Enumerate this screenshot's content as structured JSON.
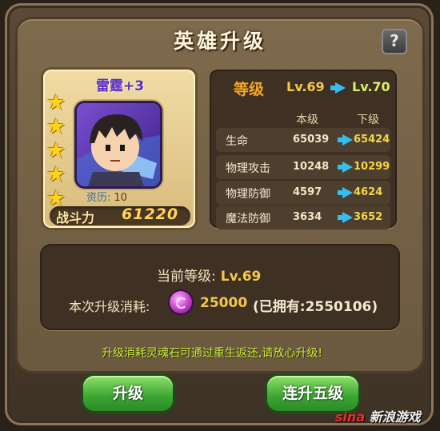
{
  "dialog": {
    "title": "英雄升级",
    "help_label": "?"
  },
  "hero": {
    "name": "雷霆+3",
    "stars": 5,
    "experience_label": "资历:",
    "experience_value": "10",
    "power_label": "战斗力",
    "power_value": "61220"
  },
  "level": {
    "label": "等级",
    "current": "Lv.69",
    "next": "Lv.70"
  },
  "stats": {
    "headers": {
      "current": "本级",
      "next": "下级"
    },
    "rows": [
      {
        "label": "生命",
        "current": "65039",
        "next": "65424"
      },
      {
        "label": "物理攻击",
        "current": "10248",
        "next": "10299"
      },
      {
        "label": "物理防御",
        "current": "4597",
        "next": "4624"
      },
      {
        "label": "魔法防御",
        "current": "3634",
        "next": "3652"
      }
    ]
  },
  "upgrade_info": {
    "current_level_label": "当前等级:",
    "current_level_value": "Lv.69",
    "cost_label": "本次升级消耗:",
    "cost_value": "25000",
    "owned_text": "(已拥有:2550106)"
  },
  "tip": "升级消耗灵魂石可通过重生返还,请放心升级!",
  "buttons": {
    "upgrade": "升级",
    "upgrade_five": "连升五级"
  },
  "watermark": {
    "logo": "sina",
    "text": "新浪游戏"
  },
  "colors": {
    "button_green": "#3aa532",
    "panel_brown": "#7e6a4c",
    "stat_next": "#f5d548",
    "tip": "#c9ef3a"
  }
}
